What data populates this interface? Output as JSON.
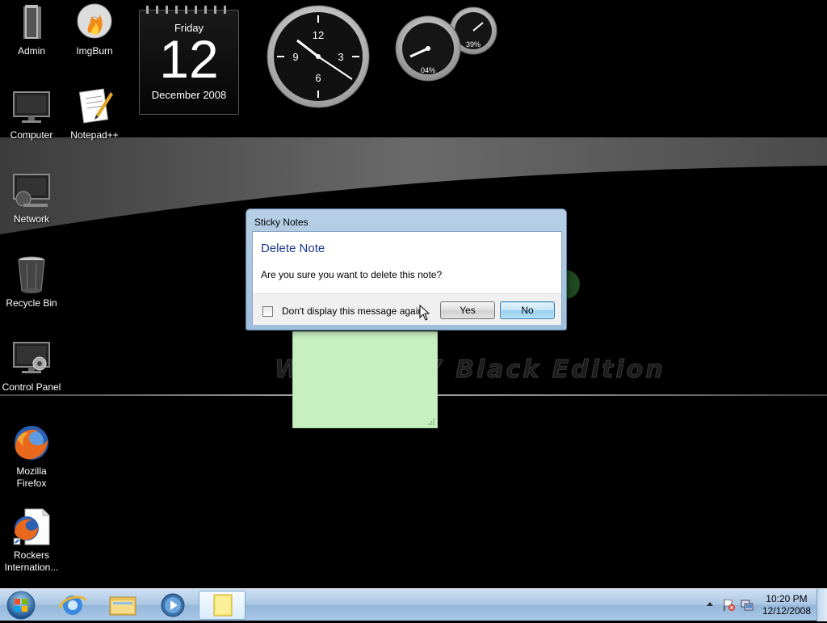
{
  "desktop": {
    "icons": [
      {
        "label": "Admin",
        "icon": "folder-icon"
      },
      {
        "label": "ImgBurn",
        "icon": "disc-burn-icon"
      },
      {
        "label": "Computer",
        "icon": "computer-icon"
      },
      {
        "label": "Notepad++",
        "icon": "notepad-icon"
      },
      {
        "label": "Network",
        "icon": "network-icon"
      },
      {
        "label": "Recycle Bin",
        "icon": "recycle-bin-icon"
      },
      {
        "label": "Control Panel",
        "icon": "control-panel-icon"
      },
      {
        "label": "Mozilla\nFirefox",
        "icon": "firefox-icon"
      },
      {
        "label": "Rockers\nInternation...",
        "icon": "firefox-shortcut-icon"
      }
    ],
    "wallpaper_text": "Windows 7 Black Edition"
  },
  "gadgets": {
    "calendar": {
      "day": "Friday",
      "date": "12",
      "month": "December 2008"
    },
    "clock": {
      "numerals": [
        "12",
        "3",
        "6",
        "9"
      ]
    },
    "cpu_meter": {
      "cpu_label": "04%",
      "memory_label": "39%",
      "cpu_value": 4,
      "memory_value": 39
    }
  },
  "dialog": {
    "title": "Sticky Notes",
    "heading": "Delete Note",
    "message": "Are you sure you want to delete this note?",
    "checkbox_label": "Don't display this message again",
    "checkbox_checked": false,
    "yes_label": "Yes",
    "no_label": "No"
  },
  "taskbar": {
    "items": [
      "start-orb-icon",
      "internet-explorer-icon",
      "explorer-folder-icon",
      "media-player-icon",
      "sticky-notes-icon"
    ],
    "clock_time": "10:20 PM",
    "clock_date": "12/12/2008"
  },
  "colors": {
    "dialog_heading": "#1a3a8f",
    "sticky_note": "#c8efc0",
    "taskbar": "#a9c6e4"
  }
}
